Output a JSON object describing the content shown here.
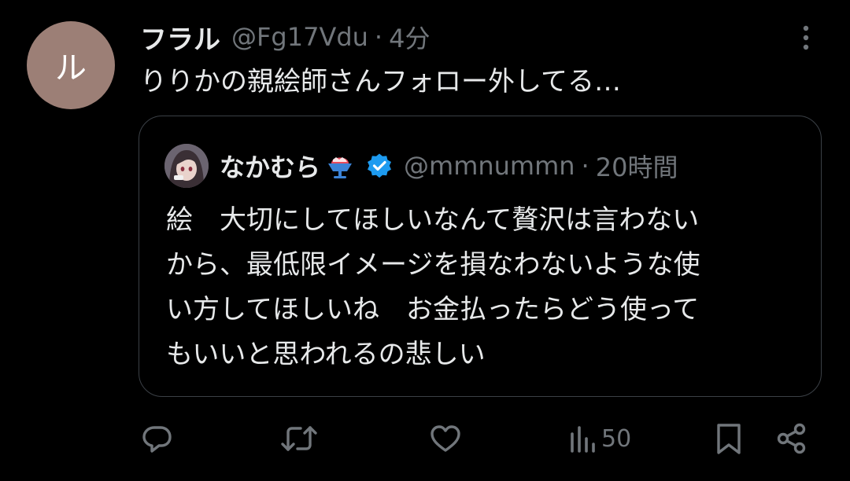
{
  "tweet": {
    "avatar_text": "ル",
    "display_name": "フラル",
    "handle": "@Fg17Vdu",
    "separator": "·",
    "time": "4分",
    "text": "りりかの親絵師さんフォロー外してる…"
  },
  "quote": {
    "display_name": "なかむら",
    "handle": "@mmnummn",
    "separator": "·",
    "time": "20時間",
    "lines": [
      "絵　大切にしてほしいなんて贅沢は言わない",
      "から、最低限イメージを損なわないような使",
      "い方してほしいね　お金払ったらどう使って",
      "もいいと思われるの悲しい"
    ]
  },
  "actions": {
    "views_count": "50"
  },
  "colors": {
    "background": "#000000",
    "text": "#e7e9ea",
    "muted": "#71767b",
    "border": "#3b4046",
    "avatar": "#9c7f76",
    "verified": "#1d9bf0"
  },
  "icons": {
    "more": "more-vertical-icon",
    "verified": "verified-badge-icon",
    "emoji": "shaved-ice-emoji-icon",
    "reply": "reply-icon",
    "retweet": "retweet-icon",
    "like": "heart-icon",
    "views": "views-icon",
    "bookmark": "bookmark-icon",
    "share": "share-icon"
  }
}
